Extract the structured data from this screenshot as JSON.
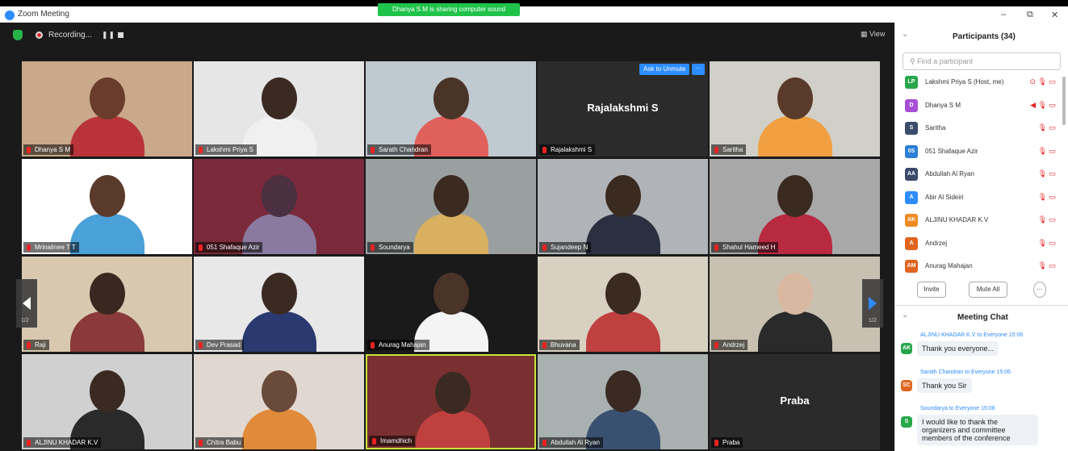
{
  "window": {
    "title": "Zoom Meeting",
    "share_banner": "Dhanya S M is sharing computer sound",
    "minimize": "–",
    "restore": "⧉",
    "close": "✕"
  },
  "toolbar": {
    "recording_label": "Recording...",
    "pause": "❚❚",
    "view_label": "▦ View"
  },
  "grid": {
    "page_left": "1/2",
    "page_right": "1/2",
    "ask_unmute": "Ask to Unmute",
    "more": "···",
    "tiles": [
      {
        "name": "Dhanya S M",
        "big": ""
      },
      {
        "name": "Lakshmi Priya S",
        "big": ""
      },
      {
        "name": "Sarath Chandran",
        "big": ""
      },
      {
        "name": "Rajalakshmi S",
        "big": "Rajalakshmi S"
      },
      {
        "name": "Saritha",
        "big": ""
      },
      {
        "name": "Mrinalinee T T",
        "big": ""
      },
      {
        "name": "051 Shafaque Azir",
        "big": ""
      },
      {
        "name": "Soundarya",
        "big": ""
      },
      {
        "name": "Sujandeep N",
        "big": ""
      },
      {
        "name": "Shahul Hameed H",
        "big": ""
      },
      {
        "name": "Raji",
        "big": ""
      },
      {
        "name": "Dev Prasad",
        "big": ""
      },
      {
        "name": "Anurag Mahajan",
        "big": ""
      },
      {
        "name": "Bhuvana",
        "big": ""
      },
      {
        "name": "Andrzej",
        "big": ""
      },
      {
        "name": "ALJINU KHADAR K.V",
        "big": ""
      },
      {
        "name": "Chitra Babu",
        "big": ""
      },
      {
        "name": "Imamdhich",
        "big": ""
      },
      {
        "name": "Abdullah Al Ryan",
        "big": ""
      },
      {
        "name": "Praba",
        "big": "Praba"
      }
    ]
  },
  "participants": {
    "title": "Participants (34)",
    "search_placeholder": "Find a participant",
    "collapse": "⌄",
    "list": [
      {
        "initials": "LP",
        "name": "Lakshmi Priya S (Host, me)",
        "color": "#27a74a",
        "icons": "⊙ 🎙 ▭"
      },
      {
        "initials": "D",
        "name": "Dhanya S M",
        "color": "#a84fd6",
        "icons": "◀ 🎙 ▭"
      },
      {
        "initials": "S",
        "name": "Saritha",
        "color": "#3a4b6b",
        "icons": "🎙 ▭"
      },
      {
        "initials": "0S",
        "name": "051 Shafaque Azir",
        "color": "#2b7fd6",
        "icons": "🎙 ▭"
      },
      {
        "initials": "AA",
        "name": "Abdullah Al Ryan",
        "color": "#3a4b6b",
        "icons": "🎙 ▭"
      },
      {
        "initials": "A",
        "name": "Abir Al Sideiri",
        "color": "#2d8cff",
        "icons": "🎙 ▭"
      },
      {
        "initials": "AK",
        "name": "ALJINU KHADAR K.V",
        "color": "#f08a24",
        "icons": "🎙 ▭"
      },
      {
        "initials": "A",
        "name": "Andrzej",
        "color": "#e0641e",
        "icons": "🎙 ▭"
      },
      {
        "initials": "AM",
        "name": "Anurag Mahajan",
        "color": "#e0641e",
        "icons": "🎙 ▭"
      }
    ],
    "invite": "Invite",
    "mute_all": "Mute All",
    "more": "···"
  },
  "chat": {
    "title": "Meeting Chat",
    "collapse": "⌄",
    "messages": [
      {
        "initials": "AK",
        "color": "#27a74a",
        "sender": "ALJINU KHADAR K.V to Everyone 15:06",
        "text": "Thank you everyone..."
      },
      {
        "initials": "SC",
        "color": "#e0641e",
        "sender": "Sarath Chandran to Everyone 15:06",
        "text": "Thank you Sir"
      },
      {
        "initials": "S",
        "color": "#27a74a",
        "sender": "Soundarya to Everyone 15:08",
        "text": "I would like to thank the organizers and committee members of the conference"
      }
    ]
  }
}
